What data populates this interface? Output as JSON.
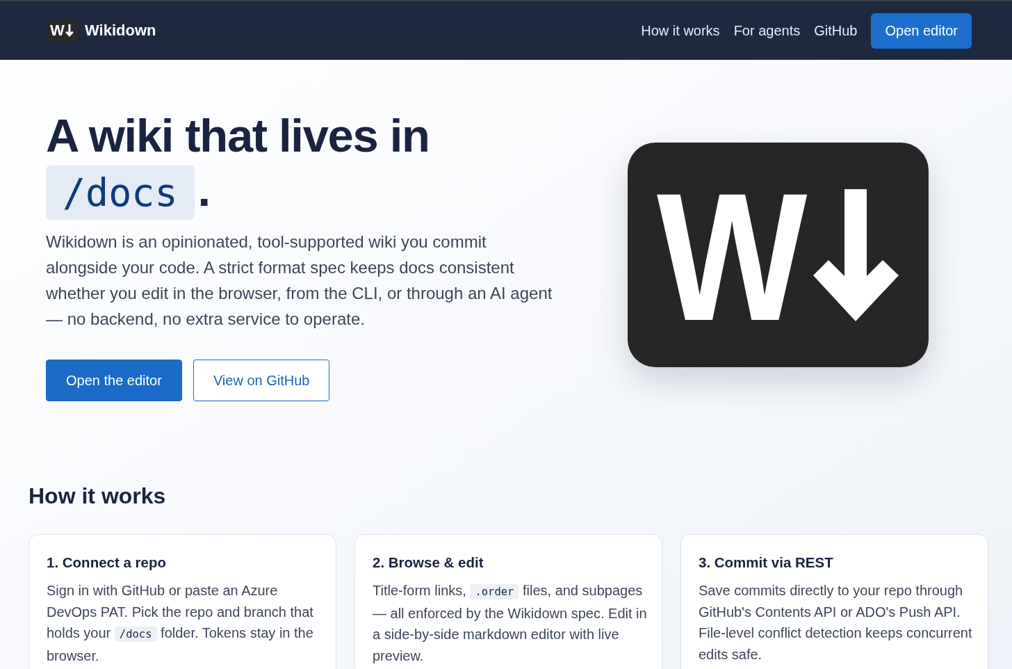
{
  "nav": {
    "logo_letter": "W",
    "brand": "Wikidown",
    "links": [
      "How it works",
      "For agents",
      "GitHub"
    ],
    "cta": "Open editor"
  },
  "hero": {
    "title": [
      {
        "kind": "text",
        "text": "A wiki that lives in "
      },
      {
        "kind": "code",
        "text": "/docs"
      },
      {
        "kind": "text",
        "text": "."
      }
    ],
    "description": "Wikidown is an opinionated, tool-supported wiki you commit alongside your code. A strict format spec keeps docs consistent whether you edit in the browser, from the CLI, or through an AI agent — no backend, no extra service to operate.",
    "buttons": [
      {
        "kind": "primary",
        "label": "Open the editor"
      },
      {
        "kind": "outline",
        "label": "View on GitHub"
      }
    ],
    "logo_letter": "W"
  },
  "how_it_works": {
    "heading": "How it works",
    "cards": [
      {
        "title": "1. Connect a repo",
        "body": [
          {
            "kind": "text",
            "text": "Sign in with GitHub or paste an Azure DevOps PAT. Pick the repo and branch that holds your "
          },
          {
            "kind": "code",
            "text": "/docs"
          },
          {
            "kind": "text",
            "text": " folder. Tokens stay in the browser."
          }
        ]
      },
      {
        "title": "2. Browse & edit",
        "body": [
          {
            "kind": "text",
            "text": "Title-form links, "
          },
          {
            "kind": "code",
            "text": ".order"
          },
          {
            "kind": "text",
            "text": " files, and subpages — all enforced by the Wikidown spec. Edit in a side-by-side markdown editor with live preview."
          }
        ]
      },
      {
        "title": "3. Commit via REST",
        "body": [
          {
            "kind": "text",
            "text": "Save commits directly to your repo through GitHub's Contents API or ADO's Push API. File-level conflict detection keeps concurrent edits safe."
          }
        ]
      }
    ]
  }
}
